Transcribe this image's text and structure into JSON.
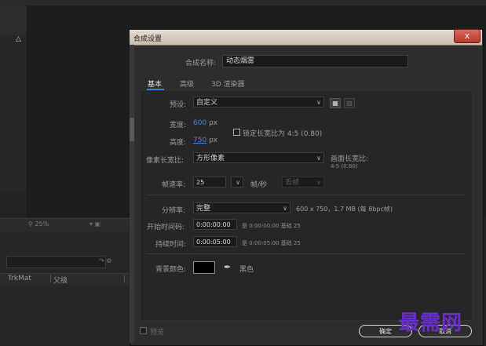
{
  "background": {
    "footer_zoom": "25%",
    "columns": [
      "TrkMat",
      "父级"
    ]
  },
  "dialog": {
    "title": "合成设置",
    "close_label": "x",
    "name_label": "合成名称:",
    "name_value": "动态烟雾",
    "tabs": [
      "基本",
      "高级",
      "3D 渲染器"
    ],
    "active_tab": "基本",
    "preset_label": "预设:",
    "preset_value": "自定义",
    "width_label": "宽度:",
    "width_value": "600",
    "height_label": "高度:",
    "height_value": "750",
    "unit_px": "px",
    "lock_label": "锁定长宽比为 4:5 (0.80)",
    "pixel_aspect_label": "像素长宽比:",
    "pixel_aspect_value": "方形像素",
    "frame_aspect_label": "画面长宽比:",
    "frame_aspect_value": "4:5 (0.80)",
    "frame_rate_label": "帧速率:",
    "frame_rate_value": "25",
    "frame_rate_unit": "帧/秒",
    "drop_frame": "丢帧",
    "resolution_label": "分辨率:",
    "resolution_value": "完整",
    "resolution_info": "600 x 750，1.7 MB (每 8bpc帧)",
    "start_tc_label": "开始时间码:",
    "start_tc_value": "0:00:00:00",
    "start_tc_note": "是 0:00:00:00  基础 25",
    "duration_label": "持续时间:",
    "duration_value": "0:00:05:00",
    "duration_note": "是 0:00:05:00  基础 25",
    "bg_color_label": "背景颜色:",
    "bg_color_name": "黑色",
    "bg_color": "#000000",
    "preview_label": "预览",
    "ok_label": "确定",
    "cancel_label": "取消"
  },
  "watermark": "最需网",
  "colors": {
    "accent_blue": "#3f8bd9",
    "watermark": "#6b2fc7"
  }
}
